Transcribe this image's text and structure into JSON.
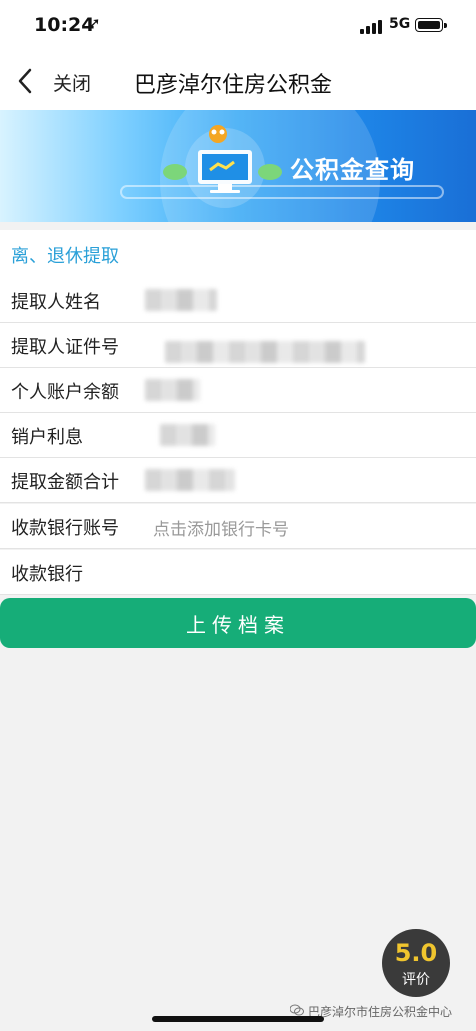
{
  "status_bar": {
    "time": "10:24",
    "location_glyph": "➚",
    "network": "5G"
  },
  "nav": {
    "close_label": "关闭",
    "title": "巴彦淖尔住房公积金"
  },
  "banner": {
    "title": "公积金查询"
  },
  "section": {
    "title": "离、退休提取"
  },
  "form": {
    "rows": [
      {
        "label": "提取人姓名",
        "value": ""
      },
      {
        "label": "提取人证件号",
        "value": ""
      },
      {
        "label": "个人账户余额",
        "value": ""
      },
      {
        "label": "销户利息",
        "value": ""
      },
      {
        "label": "提取金额合计",
        "value": ""
      },
      {
        "label": "收款银行账号",
        "placeholder": "点击添加银行卡号"
      },
      {
        "label": "收款银行",
        "value": ""
      }
    ]
  },
  "upload_button": {
    "label": "上传档案",
    "color": "#16ad78"
  },
  "rating": {
    "score": "5.0",
    "label": "评价"
  },
  "watermark": {
    "text": "巴彦淖尔市住房公积金中心"
  },
  "colors": {
    "accent": "#2aa0d8",
    "primary": "#16ad78"
  }
}
